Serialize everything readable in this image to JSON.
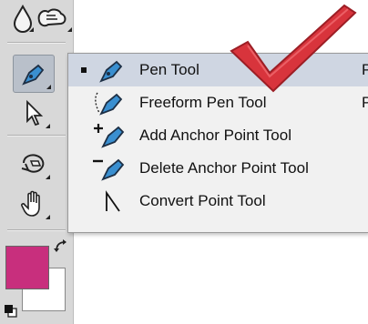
{
  "toolbar": {
    "foreground_color": "#c82f7d",
    "background_color": "#ffffff"
  },
  "flyout": {
    "items": [
      {
        "label": "Pen Tool",
        "shortcut": "P",
        "selected": true,
        "icon": "pen-icon"
      },
      {
        "label": "Freeform Pen Tool",
        "shortcut": "P",
        "selected": false,
        "icon": "freeform-pen-icon"
      },
      {
        "label": "Add Anchor Point Tool",
        "shortcut": "",
        "selected": false,
        "icon": "add-anchor-point-icon"
      },
      {
        "label": "Delete Anchor Point Tool",
        "shortcut": "",
        "selected": false,
        "icon": "delete-anchor-point-icon"
      },
      {
        "label": "Convert Point Tool",
        "shortcut": "",
        "selected": false,
        "icon": "convert-point-icon"
      }
    ]
  },
  "annotation": {
    "icon": "checkmark-icon",
    "color": "#d8343c"
  }
}
